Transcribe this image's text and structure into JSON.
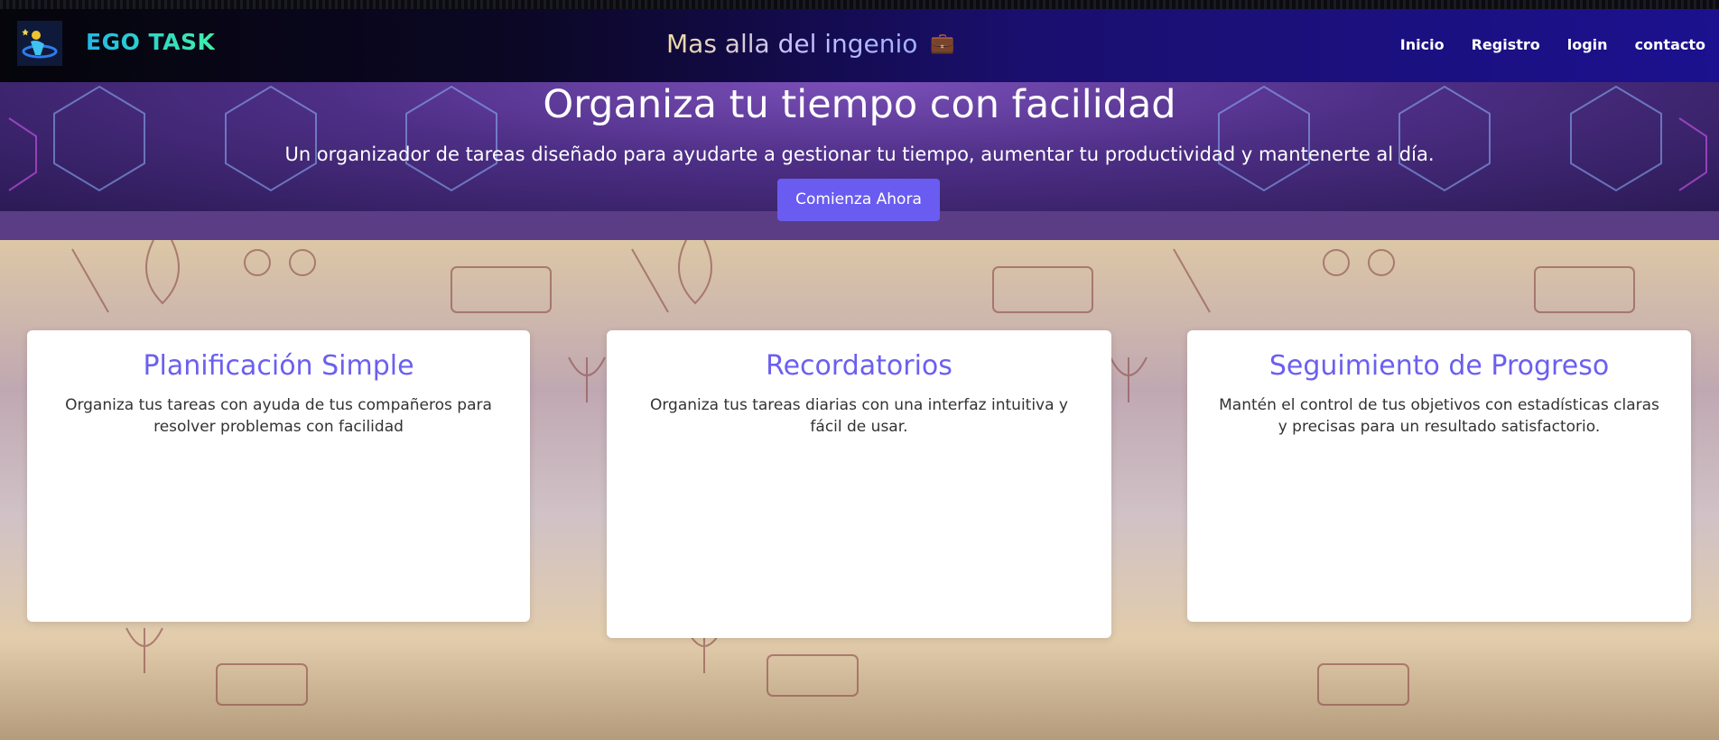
{
  "header": {
    "brand": "EGO TASK",
    "tagline": "Mas alla del ingenio",
    "tagline_icon": "briefcase-icon",
    "nav": [
      "Inicio",
      "Registro",
      "login",
      "contacto"
    ]
  },
  "hero": {
    "title": "Organiza tu tiempo con facilidad",
    "subtitle": "Un organizador de tareas diseñado para ayudarte a gestionar tu tiempo, aumentar tu productividad y mantenerte al día.",
    "cta": "Comienza Ahora"
  },
  "features": [
    {
      "title": "Planificación Simple",
      "text": "Organiza tus tareas con ayuda de tus compañeros para resolver problemas con facilidad"
    },
    {
      "title": "Recordatorios",
      "text": "Organiza tus tareas diarias con una interfaz intuitiva y fácil de usar."
    },
    {
      "title": "Seguimiento de Progreso",
      "text": "Mantén el control de tus objetivos con estadísticas claras y precisas para un resultado satisfactorio."
    }
  ],
  "colors": {
    "accent": "#6a5cf0",
    "card_title": "#6b5ff0",
    "brand_gradient_start": "#1fb8e8",
    "brand_gradient_end": "#3ff2a8"
  }
}
